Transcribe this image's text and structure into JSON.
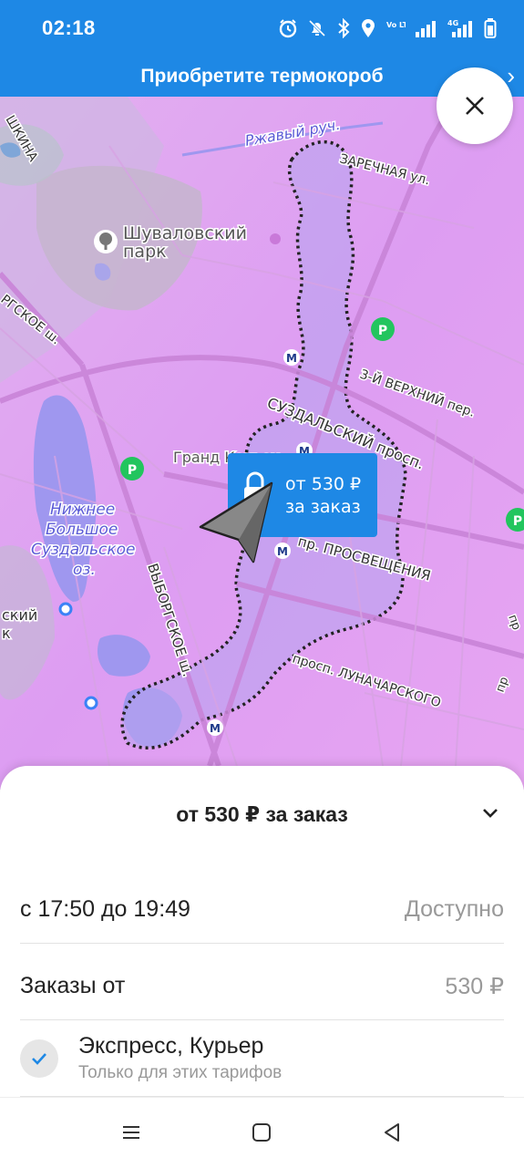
{
  "status_bar": {
    "time": "02:18",
    "icons": [
      "alarm-icon",
      "bell-off-icon",
      "bluetooth-icon",
      "location-icon",
      "volte-icon",
      "signal-icon",
      "4g-signal-icon",
      "battery-icon"
    ],
    "volte_label": "Vo LTE",
    "net_label": "4G"
  },
  "banner": {
    "text": "Приобретите термокороб"
  },
  "map": {
    "labels": {
      "street_top_left": "ШКИНА",
      "stream": "Ржавый руч.",
      "zarechnaya": "ЗАРЕЧНАЯ ул.",
      "park": "Шуваловский парк",
      "park_line1": "Шуваловский",
      "park_line2": "парк",
      "road_left": "РГСКОЕ ш.",
      "third_upper": "3-Й ВЕРХНИЙ пер.",
      "suzdalsky": "СУЗДАЛЬСКИЙ просп.",
      "grand_kanyon": "Гранд Каньон",
      "lake1": "Нижнее",
      "lake2": "Большое",
      "lake3": "Суздальское",
      "lake4": "оз.",
      "vyborgskoe": "ВЫБОРГСКОЕ ш.",
      "prosvesheniya": "пр. ПРОСВЕЩЕНИЯ",
      "lunacharskogo": "просп. ЛУНАЧАРСКОГО",
      "left_edge_1": "ский",
      "left_edge_2": "к",
      "right_edge_1": "пр",
      "right_edge_2": "пр"
    },
    "zone_tag": {
      "line1": "от 530 ₽",
      "line2": "за заказ"
    },
    "colors": {
      "zone_fill": "#dd9ff0",
      "polygon_fill": "#b9a4ef",
      "water": "#9f97ef",
      "banner_blue": "#1e88e5",
      "tag_blue": "#1e88e5"
    }
  },
  "sheet": {
    "title": "от 530 ₽ за заказ",
    "time_window": "с 17:50 до 19:49",
    "availability": "Доступно",
    "orders_from_label": "Заказы от",
    "orders_from_value": "530 ₽",
    "tariff_title": "Экспресс, Курьер",
    "tariff_sub": "Только для этих тарифов"
  },
  "navigation": {
    "buttons": [
      "menu-icon",
      "home-icon",
      "back-icon"
    ]
  }
}
